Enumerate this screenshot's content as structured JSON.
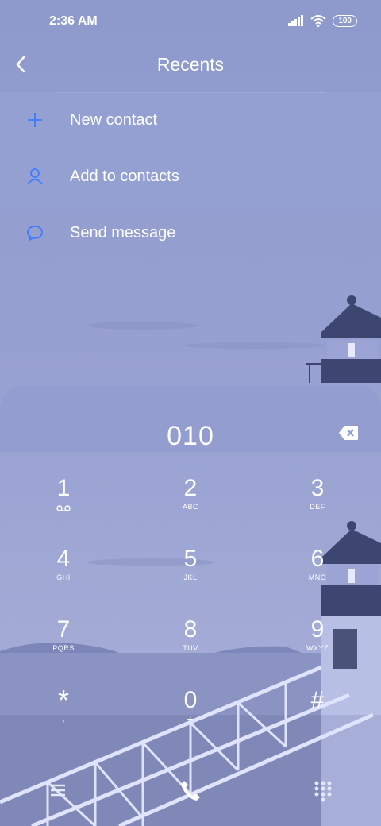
{
  "status": {
    "time": "2:36 AM",
    "battery": "100"
  },
  "header": {
    "title": "Recents"
  },
  "menu": [
    {
      "label": "New contact",
      "icon": "plus-icon"
    },
    {
      "label": "Add to contacts",
      "icon": "person-icon"
    },
    {
      "label": "Send message",
      "icon": "message-icon"
    }
  ],
  "dialer": {
    "number": "010",
    "keys": [
      {
        "digit": "1",
        "letters": ""
      },
      {
        "digit": "2",
        "letters": "ABC"
      },
      {
        "digit": "3",
        "letters": "DEF"
      },
      {
        "digit": "4",
        "letters": "GHI"
      },
      {
        "digit": "5",
        "letters": "JKL"
      },
      {
        "digit": "6",
        "letters": "MNO"
      },
      {
        "digit": "7",
        "letters": "PQRS"
      },
      {
        "digit": "8",
        "letters": "TUV"
      },
      {
        "digit": "9",
        "letters": "WXYZ"
      },
      {
        "digit": "*",
        "letters": ","
      },
      {
        "digit": "0",
        "letters": "+"
      },
      {
        "digit": "#",
        "letters": ""
      }
    ]
  },
  "colors": {
    "accent": "#3d7bff",
    "overlay": "#939dd0"
  }
}
